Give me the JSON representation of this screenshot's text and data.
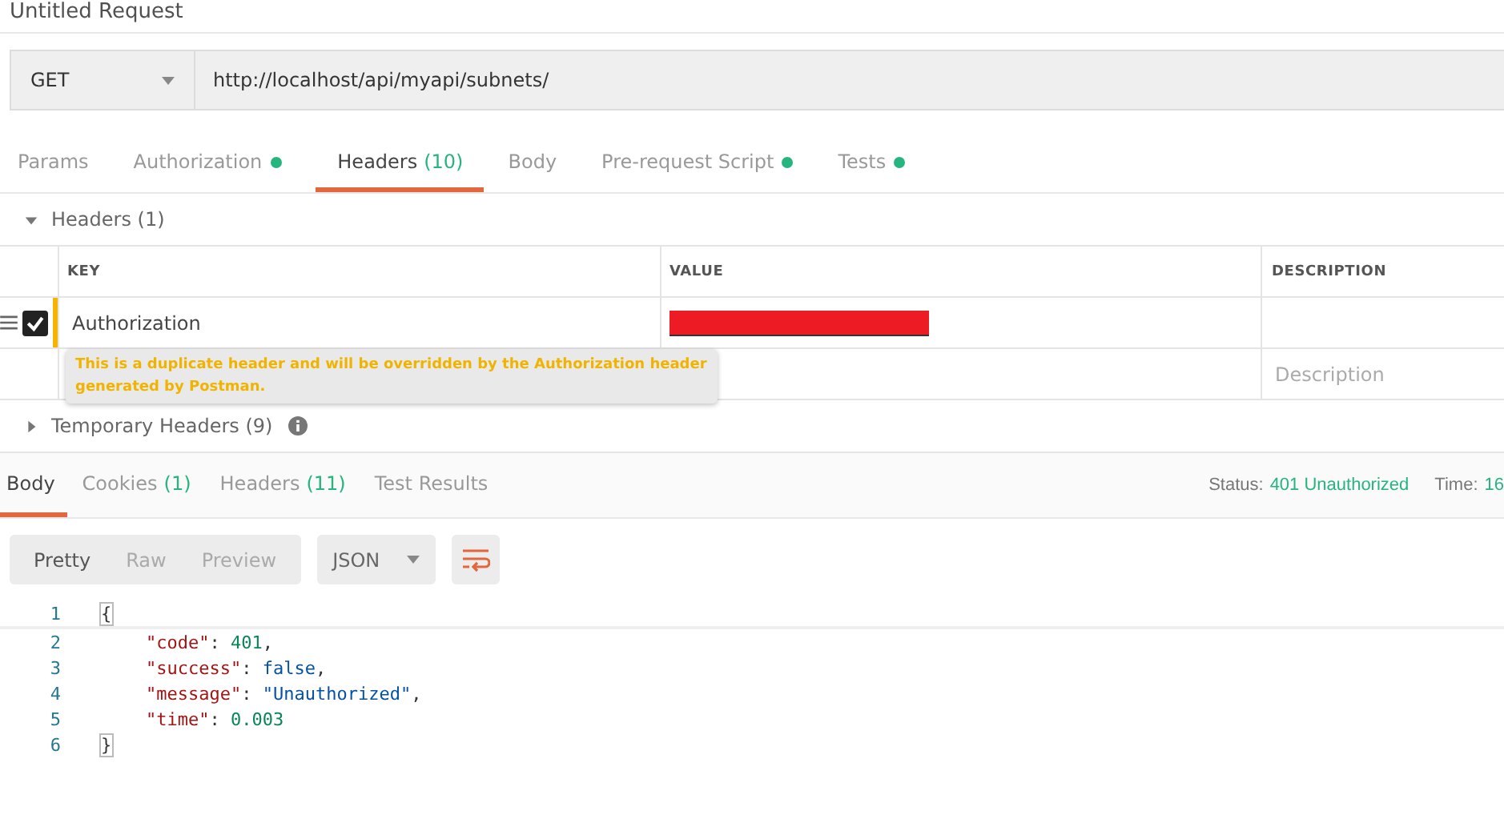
{
  "request": {
    "title": "Untitled Request",
    "method": "GET",
    "url": "http://localhost/api/myapi/subnets/"
  },
  "request_tabs": [
    {
      "label": "Params",
      "dot": false,
      "selected": false
    },
    {
      "label": "Authorization",
      "dot": true,
      "selected": false
    },
    {
      "label": "Headers",
      "count": "(10)",
      "dot": false,
      "selected": true
    },
    {
      "label": "Body",
      "dot": false,
      "selected": false
    },
    {
      "label": "Pre-request Script",
      "dot": true,
      "selected": false
    },
    {
      "label": "Tests",
      "dot": true,
      "selected": false
    }
  ],
  "headers_section": {
    "title": "Headers (1)",
    "expanded": true,
    "columns": [
      "KEY",
      "VALUE",
      "DESCRIPTION"
    ],
    "rows": [
      {
        "checked": true,
        "key": "Authorization",
        "warning": true
      }
    ],
    "tooltip": "This is a duplicate header and will be overridden by the Authorization header generated by Postman.",
    "new_row": {
      "description_placeholder": "Description"
    }
  },
  "temporary_headers": {
    "title": "Temporary Headers (9)",
    "expanded": false
  },
  "response_tabs": [
    {
      "label": "Body",
      "selected": true
    },
    {
      "label": "Cookies",
      "count": "(1)",
      "selected": false
    },
    {
      "label": "Headers",
      "count": "(11)",
      "selected": false
    },
    {
      "label": "Test Results",
      "selected": false
    }
  ],
  "status": {
    "status_label": "Status:",
    "status_value": "401 Unauthorized",
    "time_label": "Time:",
    "time_value": "16"
  },
  "view_modes": [
    {
      "label": "Pretty",
      "selected": true
    },
    {
      "label": "Raw",
      "selected": false
    },
    {
      "label": "Preview",
      "selected": false
    }
  ],
  "format": "JSON",
  "code_lines": [
    {
      "number": "1",
      "tokens": [
        {
          "kind": "bracket",
          "text": "{"
        }
      ],
      "children": [
        {
          "number": "2",
          "tokens": [
            {
              "kind": "key",
              "text": "\"code\""
            },
            {
              "kind": "punct",
              "text": ": "
            },
            {
              "kind": "number",
              "text": "401"
            },
            {
              "kind": "punct",
              "text": ","
            }
          ]
        },
        {
          "number": "3",
          "tokens": [
            {
              "kind": "key",
              "text": "\"success\""
            },
            {
              "kind": "punct",
              "text": ": "
            },
            {
              "kind": "bool",
              "text": "false"
            },
            {
              "kind": "punct",
              "text": ","
            }
          ]
        },
        {
          "number": "4",
          "tokens": [
            {
              "kind": "key",
              "text": "\"message\""
            },
            {
              "kind": "punct",
              "text": ": "
            },
            {
              "kind": "string",
              "text": "\"Unauthorized\""
            },
            {
              "kind": "punct",
              "text": ","
            }
          ]
        },
        {
          "number": "5",
          "tokens": [
            {
              "kind": "key",
              "text": "\"time\""
            },
            {
              "kind": "punct",
              "text": ": "
            },
            {
              "kind": "number",
              "text": "0.003"
            }
          ]
        }
      ]
    },
    {
      "number": "6",
      "tokens": [
        {
          "kind": "bracket",
          "text": "}"
        }
      ]
    }
  ]
}
